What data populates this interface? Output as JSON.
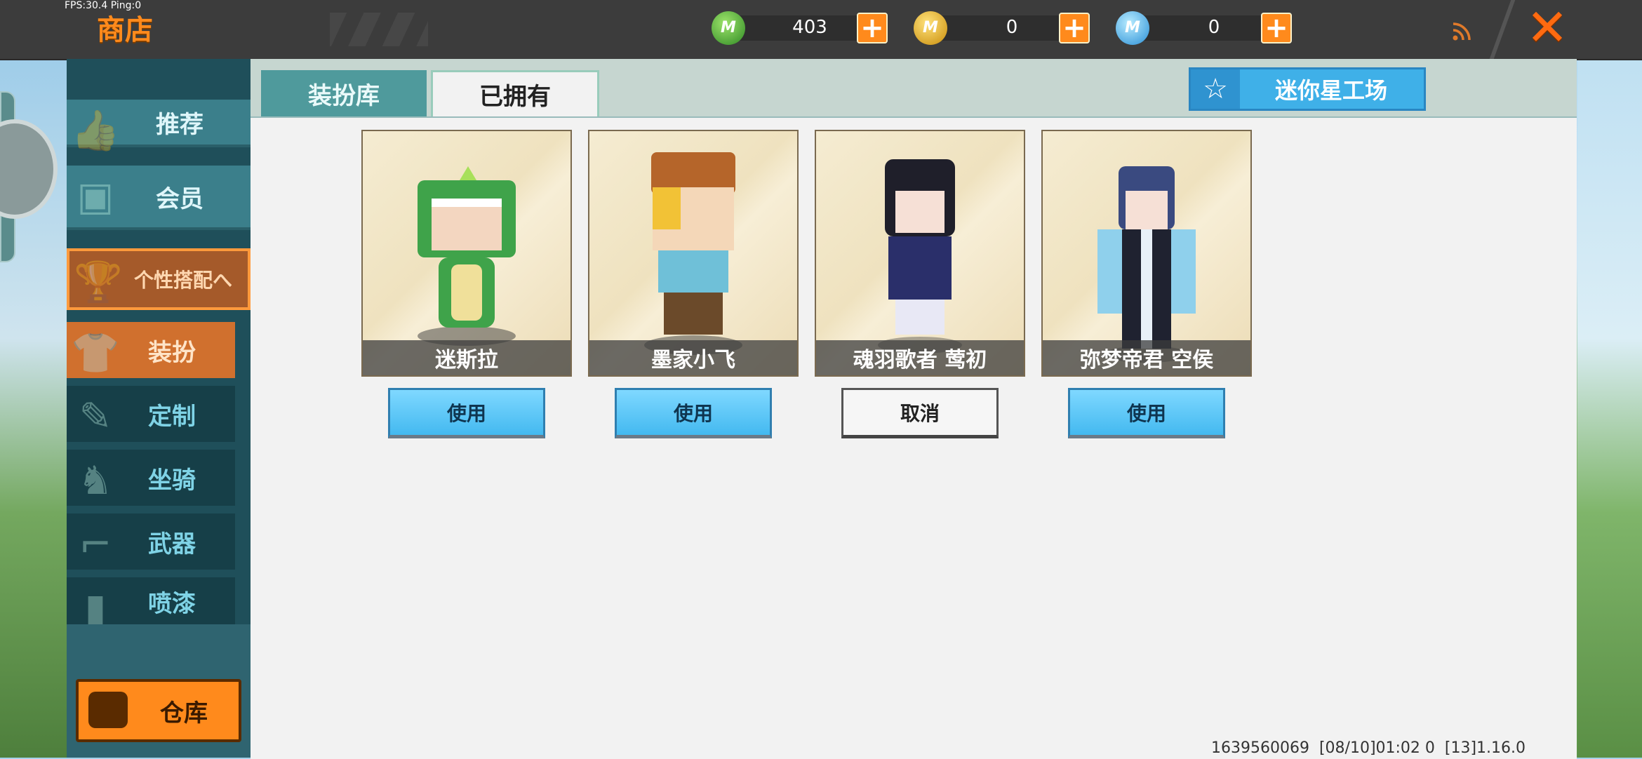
{
  "debug": {
    "fps_text": "FPS:30.4  Ping:0"
  },
  "header": {
    "title": "商店",
    "currencies": [
      {
        "icon": "green-mini-coin-icon",
        "value": "403"
      },
      {
        "icon": "gold-mini-coin-icon",
        "value": "0"
      },
      {
        "icon": "blue-mini-coin-icon",
        "value": "0"
      }
    ],
    "plus_glyph": "+",
    "close_glyph": "✕"
  },
  "sidebar": {
    "items": [
      {
        "label": "推荐",
        "icon": "thumbs-up-icon"
      },
      {
        "label": "会员",
        "icon": "vip-badge-icon"
      },
      {
        "label": "个性搭配へ",
        "icon": "trophy-icon"
      },
      {
        "label": "装扮",
        "icon": "shirt-icon"
      },
      {
        "label": "定制",
        "icon": "pencil-icon"
      },
      {
        "label": "坐骑",
        "icon": "mount-icon"
      },
      {
        "label": "武器",
        "icon": "gun-icon"
      },
      {
        "label": "喷漆",
        "icon": "spray-can-icon"
      }
    ],
    "warehouse_label": "仓库"
  },
  "tabs": [
    {
      "label": "装扮库",
      "active": false
    },
    {
      "label": "已拥有",
      "active": true
    }
  ],
  "workshop_label": "迷你星工场",
  "cards": [
    {
      "name": "迷斯拉",
      "action": "使用",
      "color": "#3fa34a"
    },
    {
      "name": "墨家小飞",
      "action": "使用",
      "color": "#b5652a"
    },
    {
      "name": "魂羽歌者 莺初",
      "action": "取消",
      "color": "#2a2f6a"
    },
    {
      "name": "弥梦帝君 空侯",
      "action": "使用",
      "color": "#3a4a80"
    }
  ],
  "footer": {
    "build_info": "1639560069  [08/10]01:02 0  [13]1.16.0"
  }
}
